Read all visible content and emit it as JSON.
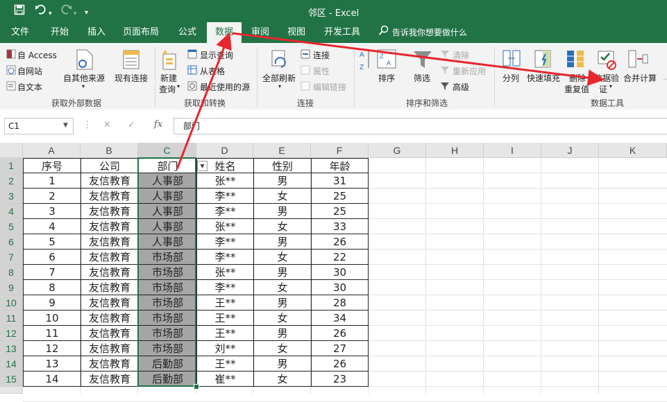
{
  "titlebar": {
    "title": "邻区  -  Excel",
    "save_icon": "save-icon",
    "undo_icon": "undo-icon",
    "redo_icon": "redo-icon",
    "customize_icon": "customize-qat-icon"
  },
  "tabs": [
    {
      "label": "文件"
    },
    {
      "label": "开始"
    },
    {
      "label": "插入"
    },
    {
      "label": "页面布局"
    },
    {
      "label": "公式"
    },
    {
      "label": "数据",
      "active": true
    },
    {
      "label": "审阅"
    },
    {
      "label": "视图"
    },
    {
      "label": "开发工具"
    }
  ],
  "tellme": "告诉我你想要做什么",
  "ribbon": {
    "get_external": {
      "access": "自 Access",
      "web": "自网站",
      "text": "自文本",
      "other": "自其他来源",
      "existing": "现有连接",
      "group_label": "获取外部数据"
    },
    "get_transform": {
      "new_query_1": "新建",
      "new_query_2": "查询",
      "show_query": "显示查询",
      "from_table": "从表格",
      "recent_sources": "最近使用的源",
      "group_label": "获取和转换"
    },
    "connections": {
      "refresh_all": "全部刷新",
      "connections": "连接",
      "properties": "属性",
      "edit_links": "编辑链接",
      "group_label": "连接"
    },
    "sort_filter": {
      "sort": "排序",
      "filter": "筛选",
      "clear": "清除",
      "reapply": "重新应用",
      "advanced": "高级",
      "group_label": "排序和筛选"
    },
    "data_tools": {
      "text_to_columns": "分列",
      "flash_fill": "快速填充",
      "remove_dup_1": "删除",
      "remove_dup_2": "重复值",
      "validation_1": "数据验",
      "validation_2": "证",
      "consolidate": "合并计算",
      "group_label": "数据工具"
    }
  },
  "formula_bar": {
    "name_box": "C1",
    "value": "部门",
    "cancel": "✕",
    "enter": "✓",
    "fx": "fx"
  },
  "columns": [
    "A",
    "B",
    "C",
    "D",
    "E",
    "F",
    "G",
    "H",
    "I",
    "J",
    "K"
  ],
  "rows": [
    "1",
    "2",
    "3",
    "4",
    "5",
    "6",
    "7",
    "8",
    "9",
    "10",
    "11",
    "12",
    "13",
    "14",
    "15"
  ],
  "table": {
    "headers": [
      "序号",
      "公司",
      "部门",
      "姓名",
      "性别",
      "年龄"
    ],
    "data": [
      [
        "1",
        "友信教育",
        "人事部",
        "张**",
        "男",
        "31"
      ],
      [
        "2",
        "友信教育",
        "人事部",
        "李**",
        "女",
        "25"
      ],
      [
        "3",
        "友信教育",
        "人事部",
        "李**",
        "男",
        "25"
      ],
      [
        "4",
        "友信教育",
        "人事部",
        "张**",
        "女",
        "33"
      ],
      [
        "5",
        "友信教育",
        "人事部",
        "李**",
        "男",
        "26"
      ],
      [
        "6",
        "友信教育",
        "市场部",
        "李**",
        "女",
        "22"
      ],
      [
        "7",
        "友信教育",
        "市场部",
        "张**",
        "男",
        "30"
      ],
      [
        "8",
        "友信教育",
        "市场部",
        "李**",
        "女",
        "30"
      ],
      [
        "9",
        "友信教育",
        "市场部",
        "王**",
        "男",
        "28"
      ],
      [
        "10",
        "友信教育",
        "市场部",
        "王**",
        "女",
        "34"
      ],
      [
        "11",
        "友信教育",
        "市场部",
        "王**",
        "男",
        "26"
      ],
      [
        "12",
        "友信教育",
        "市场部",
        "刘**",
        "女",
        "27"
      ],
      [
        "13",
        "友信教育",
        "后勤部",
        "王**",
        "男",
        "26"
      ],
      [
        "14",
        "友信教育",
        "后勤部",
        "崔**",
        "女",
        "23"
      ]
    ]
  },
  "colors": {
    "excel_green": "#217346",
    "annotation_red": "#e8262d",
    "selection_fill": "#a6a6a6"
  }
}
